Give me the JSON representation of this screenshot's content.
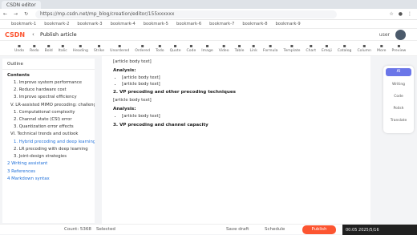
{
  "browser": {
    "tab": "CSDN editor",
    "url": "https://mp.csdn.net/mp_blog/creation/editor/155xxxxxx",
    "bookmarks": [
      "bookmark-1",
      "bookmark-2",
      "bookmark-3",
      "bookmark-4",
      "bookmark-5",
      "bookmark-6",
      "bookmark-7",
      "bookmark-8",
      "bookmark-9"
    ]
  },
  "header": {
    "logo": "CSDN",
    "title": "Publish article",
    "user": "user",
    "bell": "bell"
  },
  "toolbar": {
    "items": [
      "Undo",
      "Redo",
      "Bold",
      "Italic",
      "Heading",
      "Strike",
      "Unordered",
      "Ordered",
      "Todo",
      "Quote",
      "Code",
      "Image",
      "Video",
      "Table",
      "Link",
      "Formula",
      "Template",
      "Chart",
      "Emoji",
      "Catalog",
      "Column",
      "More",
      "Preview"
    ]
  },
  "sidebar": {
    "tabs": "Outline",
    "heading": "Contents",
    "items": [
      "1. Improve system performance",
      "2. Reduce hardware cost",
      "3. Improve spectral efficiency",
      "V. LR-assisted MIMO precoding: challenges",
      "1. Computational complexity",
      "2. Channel state (CSI) error",
      "3. Quantization error effects",
      "VI. Technical trends and outlook",
      "1. Hybrid precoding and deep learning",
      "2. LR precoding with deep learning",
      "3. Joint-design strategies"
    ],
    "footer": [
      "2 Writing assistant",
      "3 References",
      "4 Markdown syntax"
    ]
  },
  "content": {
    "intro": "[article body text]",
    "h1": "Analysis:",
    "bullets1": [
      "[article body text]",
      "[article body text]"
    ],
    "h2": "2. VP precoding and other precoding techniques",
    "p2": "[article body text]",
    "h3": "Analysis:",
    "bullets3": [
      "[article body text]"
    ],
    "h4": "3. VP precoding and channel capacity"
  },
  "ai": {
    "top": "AI",
    "items": [
      "Writing",
      "Code",
      "Polish",
      "Translate"
    ]
  },
  "bottom": {
    "count": "Count: 5368",
    "sel": "Selected",
    "save": "Save draft",
    "sched": "Schedule",
    "publish": "Publish"
  },
  "taskbar": {
    "time": "00:05",
    "date": "2025/5/16"
  }
}
